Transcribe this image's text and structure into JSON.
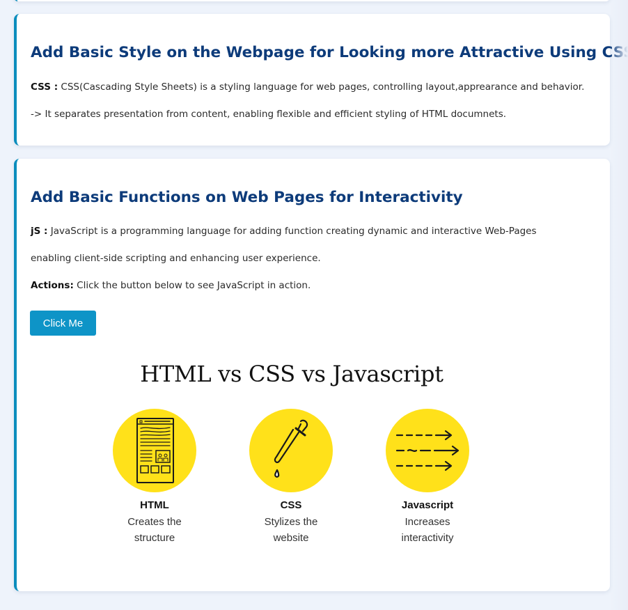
{
  "css_section": {
    "heading": "Add Basic Style on the Webpage for Looking more Attractive Using CSS",
    "label": "CSS :",
    "description": " CSS(Cascading Style Sheets) is a styling language for web pages, controlling layout,apprearance and behavior.",
    "note": "-> It separates presentation from content, enabling flexible and efficient styling of HTML documnets."
  },
  "js_section": {
    "heading": "Add Basic Functions on Web Pages for Interactivity",
    "label": "jS :",
    "description": " JavaScript is a programming language for adding function creating dynamic and interactive Web-Pages",
    "description_cont": "enabling client-side scripting and enhancing user experience.",
    "actions_label": "Actions:",
    "actions_text": " Click the button below to see JavaScript in action.",
    "button_label": "Click Me"
  },
  "infographic": {
    "title": "HTML vs CSS vs Javascript",
    "accent_color": "#ffe11a",
    "columns": [
      {
        "name": "HTML",
        "description": "Creates the\nstructure",
        "icon": "webpage-layout-icon"
      },
      {
        "name": "CSS",
        "description": "Stylizes the\nwebsite",
        "icon": "eyedropper-icon"
      },
      {
        "name": "Javascript",
        "description": "Increases\ninteractivity",
        "icon": "arrows-icon"
      }
    ]
  },
  "colors": {
    "heading": "#0d3b7a",
    "accent_border": "#0b8dbd",
    "button": "#0e94c7",
    "background": "#eef3fb"
  }
}
